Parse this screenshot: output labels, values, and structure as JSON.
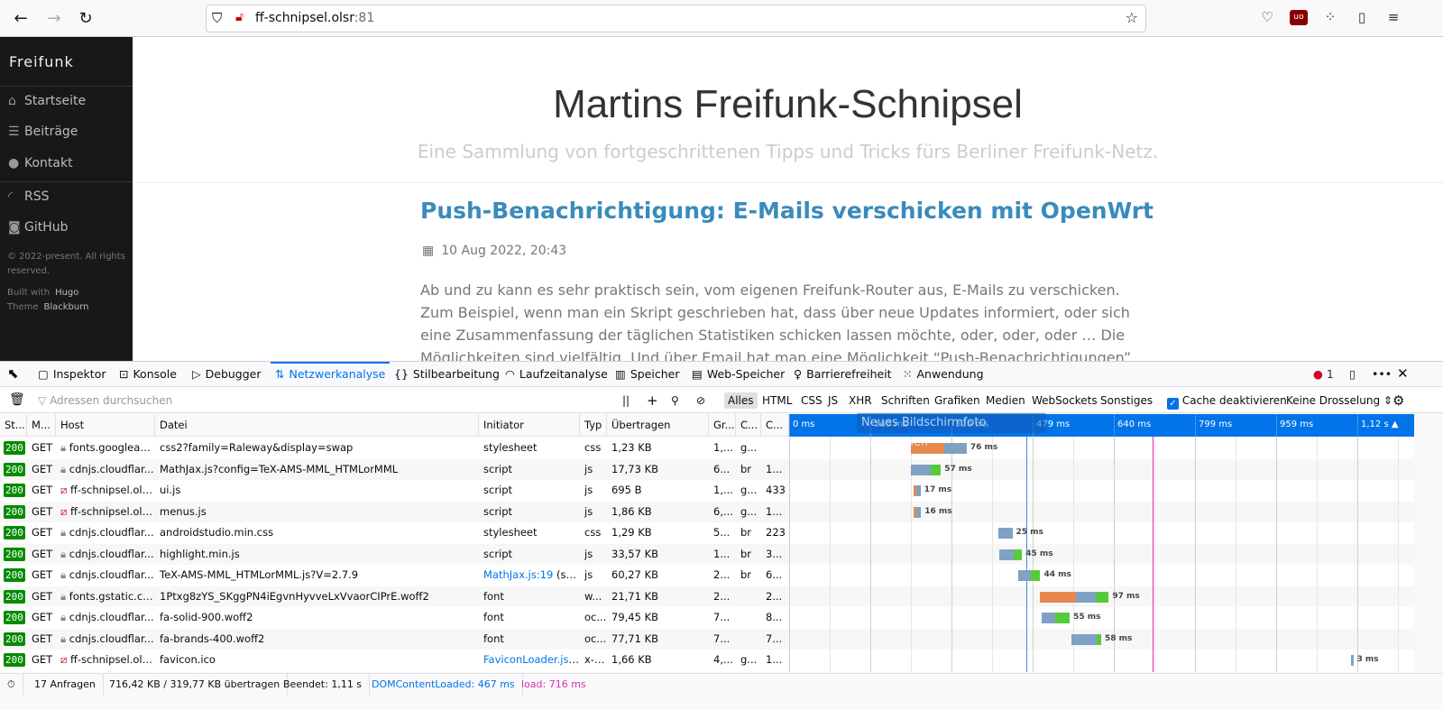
{
  "browser": {
    "url_host": "ff-schnipsel.olsr",
    "url_port": ":81",
    "icons": [
      "back-icon",
      "forward-icon",
      "reload-icon",
      "shield-icon",
      "insecure-lock-icon",
      "bookmark-star-icon",
      "pocket-icon",
      "ublock-icon",
      "extensions-icon",
      "reader-icon",
      "menu-icon"
    ]
  },
  "sidebar": {
    "brand": "Freifunk",
    "items": [
      {
        "label": "Startseite",
        "icon": "home-icon"
      },
      {
        "label": "Beiträge",
        "icon": "list-icon"
      },
      {
        "label": "Kontakt",
        "icon": "user-icon"
      },
      {
        "label": "RSS",
        "icon": "rss-icon"
      },
      {
        "label": "GitHub",
        "icon": "github-icon"
      }
    ],
    "copyright": "© 2022-present. All rights reserved.",
    "built_with": "Built with",
    "hugo": "Hugo",
    "theme": "Theme",
    "blackburn": "Blackburn"
  },
  "page": {
    "title": "Martins Freifunk-Schnipsel",
    "subtitle": "Eine Sammlung von fortgeschrittenen Tipps und Tricks fürs Berliner Freifunk-Netz.",
    "post_title": "Push-Benachrichtigung: E-Mails verschicken mit OpenWrt",
    "post_date": "10 Aug 2022, 20:43",
    "body": "Ab und zu kann es sehr praktisch sein, vom eigenen Freifunk-Router aus, E-Mails zu verschicken. Zum Beispiel, wenn man ein Skript geschrieben hat, dass über neue Updates informiert, oder sich eine Zusammenfassung der täglichen Statistiken schicken lassen möchte, oder, oder, oder … Die Möglichkeiten sind vielfältig. Und über Email hat man eine Möglichkeit “Push-Benachrichtigungen”"
  },
  "devtools": {
    "tabs": [
      "Inspektor",
      "Konsole",
      "Debugger",
      "Netzwerkanalyse",
      "Stilbearbeitung",
      "Laufzeitanalyse",
      "Speicher",
      "Web-Speicher",
      "Barrierefreiheit",
      "Anwendung"
    ],
    "active_tab": "Netzwerkanalyse",
    "error_count": "1",
    "filter_placeholder": "Adressen durchsuchen",
    "type_filters": [
      "Alles",
      "HTML",
      "CSS",
      "JS",
      "XHR",
      "Schriften",
      "Grafiken",
      "Medien",
      "WebSockets",
      "Sonstiges"
    ],
    "selected_filter": "Alles",
    "cache_label": "Cache deaktivieren",
    "cache_checked": true,
    "throttle": "Keine Drosselung",
    "tooltip": "Neues Bildschirmfoto aufnehmen",
    "columns": [
      "St...",
      "M...",
      "Host",
      "Datei",
      "Initiator",
      "Typ",
      "Übertragen",
      "Gr...",
      "C...",
      "C..."
    ],
    "timeline_ticks": [
      "0 ms",
      "160 ms",
      "320 ms",
      "479 ms",
      "640 ms",
      "799 ms",
      "959 ms",
      "1,12 s ▲"
    ],
    "dom_content_loaded_ms": 467,
    "load_ms": 716,
    "colors": {
      "blocked": "#e5894f",
      "waiting": "#7fa1c4",
      "receiving": "#56cb3a",
      "dcl": "#3b8be8",
      "load": "#e02ab4",
      "status_ok": "#058b00"
    },
    "requests": [
      {
        "status": "200",
        "method": "GET",
        "secure": true,
        "host": "fonts.googleap...",
        "file": "css2?family=Raleway&display=swap",
        "initiator": "stylesheet",
        "type": "css",
        "transferred": "1,23 KB",
        "size": "1,...",
        "c1": "g...",
        "c2": "",
        "start": 240,
        "blocked": 66,
        "waiting": 44,
        "receiving": 0,
        "duration": "76 ms"
      },
      {
        "status": "200",
        "method": "GET",
        "secure": true,
        "host": "cdnjs.cloudflar...",
        "file": "MathJax.js?config=TeX-AMS-MML_HTMLorMML",
        "initiator": "script",
        "type": "js",
        "transferred": "17,73 KB",
        "size": "6...",
        "c1": "br",
        "c2": "1...",
        "start": 240,
        "blocked": 0,
        "waiting": 39,
        "receiving": 20,
        "duration": "57 ms"
      },
      {
        "status": "200",
        "method": "GET",
        "secure": false,
        "host": "ff-schnipsel.ols...",
        "file": "ui.js",
        "initiator": "script",
        "type": "js",
        "transferred": "695 B",
        "size": "1,...",
        "c1": "g...",
        "c2": "433",
        "start": 245,
        "blocked": 5,
        "waiting": 9,
        "receiving": 0,
        "duration": "17 ms"
      },
      {
        "status": "200",
        "method": "GET",
        "secure": false,
        "host": "ff-schnipsel.ols...",
        "file": "menus.js",
        "initiator": "script",
        "type": "js",
        "transferred": "1,86 KB",
        "size": "6,...",
        "c1": "g...",
        "c2": "1...",
        "start": 246,
        "blocked": 5,
        "waiting": 9,
        "receiving": 0,
        "duration": "16 ms"
      },
      {
        "status": "200",
        "method": "GET",
        "secure": true,
        "host": "cdnjs.cloudflar...",
        "file": "androidstudio.min.css",
        "initiator": "stylesheet",
        "type": "css",
        "transferred": "1,29 KB",
        "size": "5...",
        "c1": "br",
        "c2": "223",
        "start": 413,
        "blocked": 0,
        "waiting": 27,
        "receiving": 0,
        "duration": "25 ms"
      },
      {
        "status": "200",
        "method": "GET",
        "secure": true,
        "host": "cdnjs.cloudflar...",
        "file": "highlight.min.js",
        "initiator": "script",
        "type": "js",
        "transferred": "33,57 KB",
        "size": "1...",
        "c1": "br",
        "c2": "3...",
        "start": 415,
        "blocked": 0,
        "waiting": 28,
        "receiving": 16,
        "duration": "45 ms"
      },
      {
        "status": "200",
        "method": "GET",
        "secure": true,
        "host": "cdnjs.cloudflar...",
        "file": "TeX-AMS-MML_HTMLorMML.js?V=2.7.9",
        "initiator": "MathJax.js:19",
        "initiator_extra": " (scri...",
        "type": "js",
        "transferred": "60,27 KB",
        "size": "2...",
        "c1": "br",
        "c2": "6...",
        "start": 452,
        "blocked": 0,
        "waiting": 25,
        "receiving": 18,
        "duration": "44 ms"
      },
      {
        "status": "200",
        "method": "GET",
        "secure": true,
        "host": "fonts.gstatic.com",
        "file": "1Ptxg8zYS_SKggPN4iEgvnHyvveLxVvaorCIPrE.woff2",
        "initiator": "font",
        "type": "w...",
        "transferred": "21,71 KB",
        "size": "2...",
        "c1": "",
        "c2": "2...",
        "start": 494,
        "blocked": 72,
        "waiting": 39,
        "receiving": 25,
        "duration": "97 ms"
      },
      {
        "status": "200",
        "method": "GET",
        "secure": true,
        "host": "cdnjs.cloudflar...",
        "file": "fa-solid-900.woff2",
        "initiator": "font",
        "type": "oc...",
        "transferred": "79,45 KB",
        "size": "7...",
        "c1": "",
        "c2": "8...",
        "start": 498,
        "blocked": 0,
        "waiting": 27,
        "receiving": 28,
        "duration": "55 ms"
      },
      {
        "status": "200",
        "method": "GET",
        "secure": true,
        "host": "cdnjs.cloudflar...",
        "file": "fa-brands-400.woff2",
        "initiator": "font",
        "type": "oc...",
        "transferred": "77,71 KB",
        "size": "7...",
        "c1": "",
        "c2": "7...",
        "start": 556,
        "blocked": 0,
        "waiting": 50,
        "receiving": 9,
        "duration": "58 ms"
      },
      {
        "status": "200",
        "method": "GET",
        "secure": false,
        "host": "ff-schnipsel.ols...",
        "file": "favicon.ico",
        "initiator": "FaviconLoader.jsm...",
        "type": "x-i...",
        "transferred": "1,66 KB",
        "size": "4,...",
        "c1": "g...",
        "c2": "1...",
        "start": 1108,
        "blocked": 0,
        "waiting": 4,
        "receiving": 0,
        "duration": "3 ms"
      }
    ],
    "status": {
      "requests": "17 Anfragen",
      "transferred": "716,42 KB / 319,77 KB übertragen",
      "finished": "Beendet: 1,11 s",
      "dcl": "DOMContentLoaded: 467 ms",
      "load": "load: 716 ms"
    }
  }
}
